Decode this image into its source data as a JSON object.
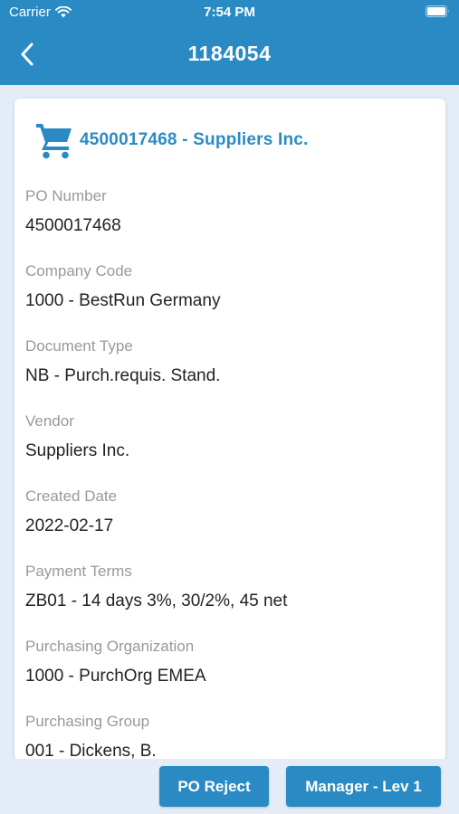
{
  "status_bar": {
    "carrier": "Carrier",
    "time": "7:54 PM",
    "wifi_icon": "wifi-icon",
    "battery_icon": "battery-icon"
  },
  "nav": {
    "title": "1184054",
    "back_icon": "chevron-left-icon"
  },
  "card": {
    "icon": "shopping-cart-icon",
    "title": "4500017468 - Suppliers Inc.",
    "fields": [
      {
        "label": "PO Number",
        "value": "4500017468"
      },
      {
        "label": "Company Code",
        "value": "1000 - BestRun Germany"
      },
      {
        "label": "Document Type",
        "value": "NB - Purch.requis. Stand."
      },
      {
        "label": "Vendor",
        "value": "Suppliers Inc."
      },
      {
        "label": "Created Date",
        "value": "2022-02-17"
      },
      {
        "label": "Payment Terms",
        "value": "ZB01 - 14 days 3%, 30/2%, 45 net"
      },
      {
        "label": "Purchasing Organization",
        "value": "1000 - PurchOrg EMEA"
      },
      {
        "label": "Purchasing Group",
        "value": "001 - Dickens, B."
      }
    ]
  },
  "actions": {
    "reject_label": "PO Reject",
    "manager_label": "Manager - Lev 1"
  },
  "colors": {
    "primary": "#2a8bc4",
    "background": "#e4ecf8",
    "label": "#999999",
    "value": "#222222"
  }
}
